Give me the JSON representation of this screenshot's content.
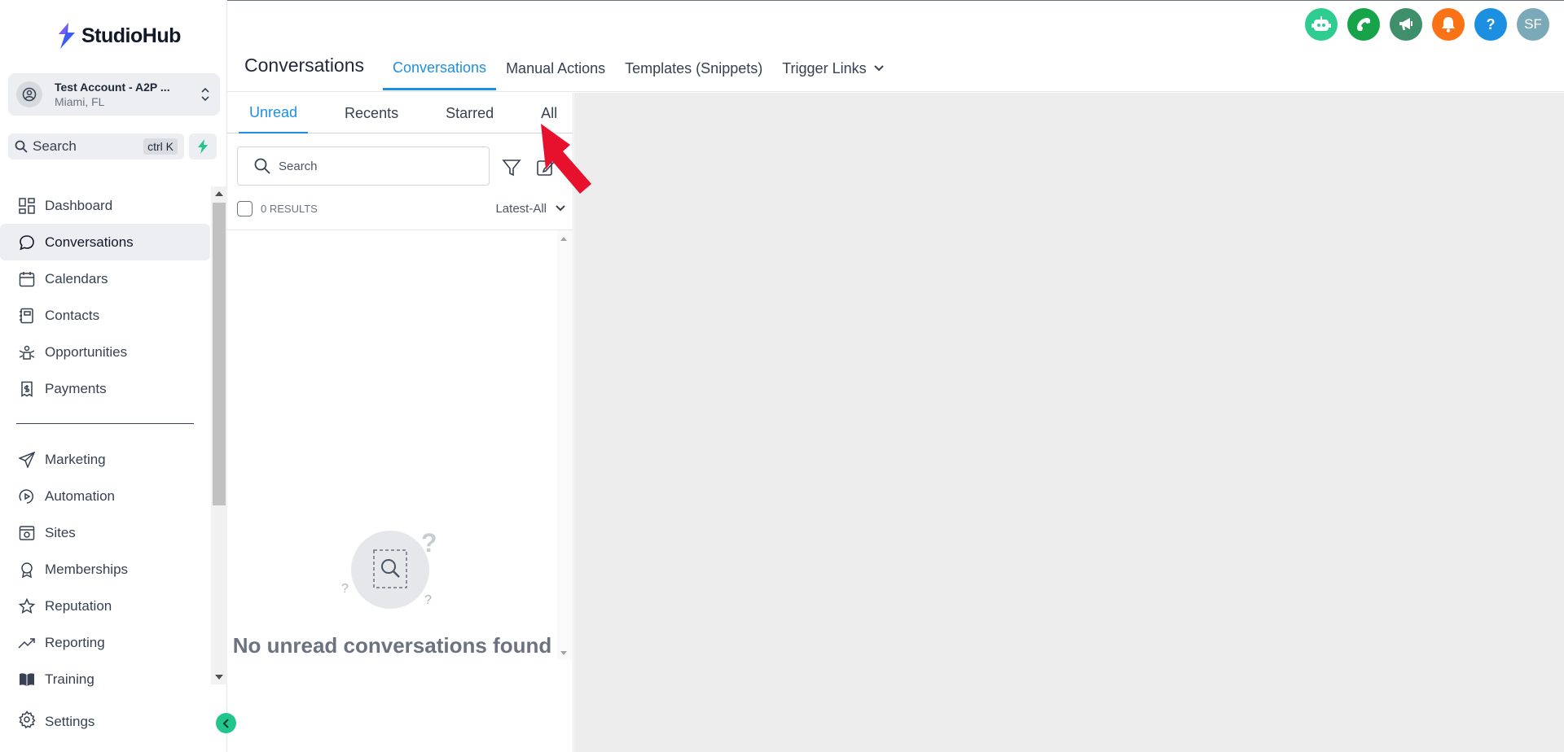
{
  "app": {
    "name": "StudioHub"
  },
  "account": {
    "name": "Test Account - A2P ...",
    "location": "Miami, FL"
  },
  "sidebar_search": {
    "label": "Search",
    "shortcut": "ctrl K"
  },
  "nav": {
    "items": [
      {
        "label": "Dashboard",
        "icon": "dashboard-icon"
      },
      {
        "label": "Conversations",
        "icon": "chat-bubble-icon",
        "active": true
      },
      {
        "label": "Calendars",
        "icon": "calendar-icon"
      },
      {
        "label": "Contacts",
        "icon": "contacts-icon"
      },
      {
        "label": "Opportunities",
        "icon": "opportunities-icon"
      },
      {
        "label": "Payments",
        "icon": "payments-icon"
      }
    ],
    "items2": [
      {
        "label": "Marketing",
        "icon": "send-icon"
      },
      {
        "label": "Automation",
        "icon": "automation-icon"
      },
      {
        "label": "Sites",
        "icon": "sites-icon"
      },
      {
        "label": "Memberships",
        "icon": "memberships-icon"
      },
      {
        "label": "Reputation",
        "icon": "star-icon"
      },
      {
        "label": "Reporting",
        "icon": "trend-icon"
      },
      {
        "label": "Training",
        "icon": "book-icon"
      }
    ],
    "settings": "Settings"
  },
  "header": {
    "title": "Conversations",
    "tabs": [
      {
        "label": "Conversations",
        "active": true
      },
      {
        "label": "Manual Actions"
      },
      {
        "label": "Templates (Snippets)"
      },
      {
        "label": "Trigger Links"
      }
    ],
    "icons": [
      {
        "name": "bot-icon",
        "color": "#2ecc8f"
      },
      {
        "name": "phone-icon",
        "color": "#16a34a"
      },
      {
        "name": "megaphone-icon",
        "color": "#3f8f6b"
      },
      {
        "name": "bell-icon",
        "color": "#f97316"
      },
      {
        "name": "help-icon",
        "color": "#1d8fe0",
        "text": "?"
      },
      {
        "name": "user-avatar",
        "color": "#7aaab8",
        "text": "SF"
      }
    ]
  },
  "conversations": {
    "tabs": [
      {
        "label": "Unread",
        "active": true
      },
      {
        "label": "Recents"
      },
      {
        "label": "Starred"
      },
      {
        "label": "All"
      }
    ],
    "search_placeholder": "Search",
    "results": "0 RESULTS",
    "sort": "Latest-All",
    "empty_message": "No unread conversations found"
  },
  "colors": {
    "accent": "#1d8fe0",
    "brand_green": "#22c58b",
    "annotation": "#e8112d"
  }
}
